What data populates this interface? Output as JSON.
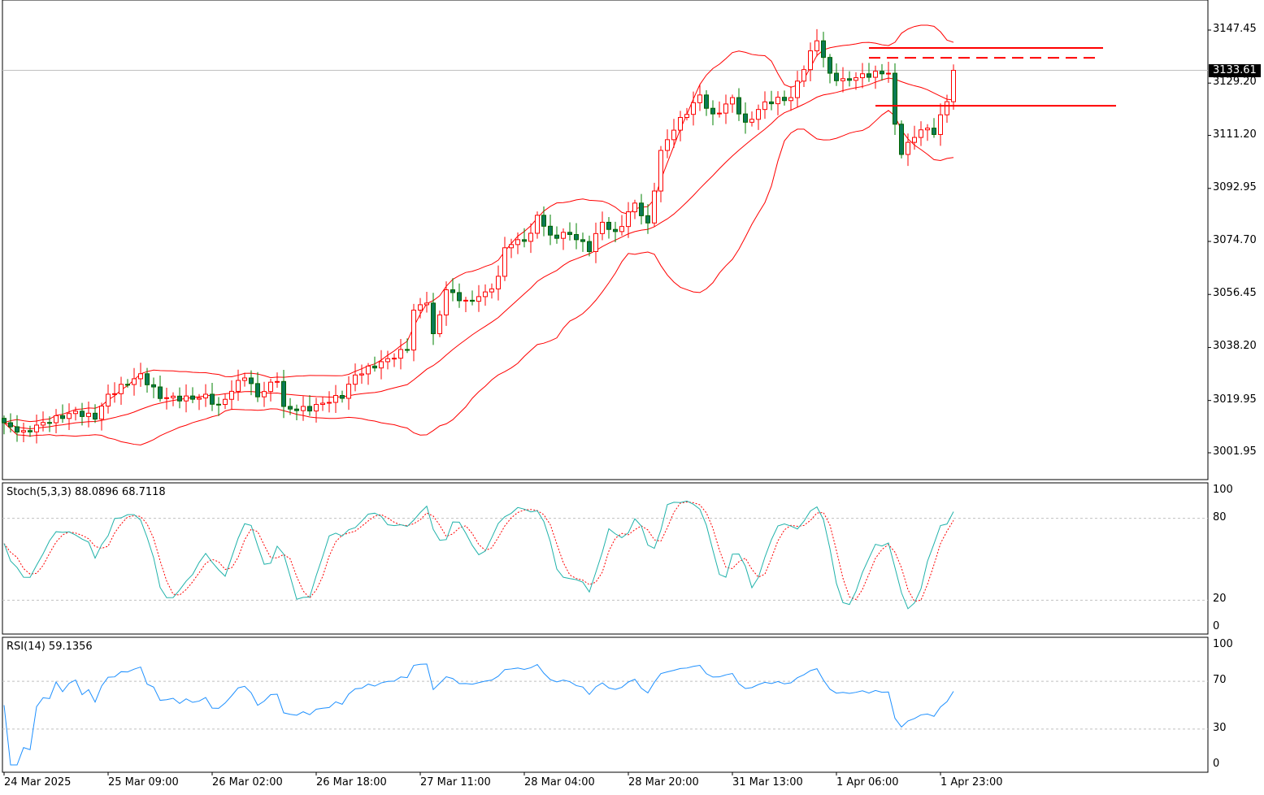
{
  "chart_data": {
    "type": "candlestick",
    "price_axis": {
      "ticks": [
        "3147.45",
        "3129.20",
        "3111.20",
        "3092.95",
        "3074.70",
        "3056.45",
        "3038.20",
        "3019.95",
        "3001.95"
      ],
      "range": [
        3001.95,
        3147.45
      ]
    },
    "current_price": "3133.61",
    "time_axis": {
      "ticks": [
        "24 Mar 2025",
        "25 Mar 09:00",
        "26 Mar 02:00",
        "26 Mar 18:00",
        "27 Mar 11:00",
        "28 Mar 04:00",
        "28 Mar 20:00",
        "31 Mar 13:00",
        "1 Apr 06:00",
        "1 Apr 23:00"
      ],
      "bars_per_tick": 16
    },
    "price_path": [
      [
        0,
        3012.3
      ],
      [
        3,
        3008.1
      ],
      [
        7,
        3012.3
      ],
      [
        11,
        3016.5
      ],
      [
        14,
        3015.1
      ],
      [
        16,
        3022.1
      ],
      [
        21,
        3027.7
      ],
      [
        24,
        3020.7
      ],
      [
        31,
        3022.1
      ],
      [
        33,
        3017.9
      ],
      [
        37,
        3027.7
      ],
      [
        39,
        3020.7
      ],
      [
        42,
        3027.7
      ],
      [
        43,
        3017.9
      ],
      [
        47,
        3017.9
      ],
      [
        52,
        3020.7
      ],
      [
        54,
        3027.7
      ],
      [
        58,
        3033.3
      ],
      [
        62,
        3038.9
      ],
      [
        63,
        3051.5
      ],
      [
        65,
        3054.3
      ],
      [
        66,
        3041.7
      ],
      [
        68,
        3057.1
      ],
      [
        71,
        3052.9
      ],
      [
        74,
        3057.1
      ],
      [
        76,
        3062.7
      ],
      [
        77,
        3073.9
      ],
      [
        81,
        3076.7
      ],
      [
        82,
        3083.7
      ],
      [
        84,
        3075.3
      ],
      [
        87,
        3076.7
      ],
      [
        90,
        3072.5
      ],
      [
        92,
        3082.3
      ],
      [
        94,
        3078.1
      ],
      [
        97,
        3087.9
      ],
      [
        99,
        3079.5
      ],
      [
        101,
        3104.6
      ],
      [
        103,
        3113.0
      ],
      [
        107,
        3125.6
      ],
      [
        109,
        3118.6
      ],
      [
        112,
        3124.2
      ],
      [
        114,
        3114.4
      ],
      [
        117,
        3121.4
      ],
      [
        121,
        3124.2
      ],
      [
        123,
        3135.4
      ],
      [
        125,
        3145.2
      ],
      [
        127,
        3132.6
      ],
      [
        129,
        3129.8
      ],
      [
        133,
        3131.2
      ],
      [
        136,
        3132.6
      ],
      [
        137,
        3114.4
      ],
      [
        138,
        3106.0
      ],
      [
        141,
        3114.4
      ],
      [
        143,
        3113.0
      ],
      [
        145,
        3122.8
      ],
      [
        146,
        3133.6
      ]
    ],
    "horizontal_levels": [
      {
        "price": 3141.3,
        "style": "solid",
        "from_bar": 133,
        "to_bar": 169
      },
      {
        "price": 3137.9,
        "style": "dashed",
        "from_bar": 133,
        "to_bar": 168
      },
      {
        "price": 3121.4,
        "style": "solid",
        "from_bar": 134,
        "to_bar": 171
      }
    ],
    "bollinger": {
      "period": 20,
      "deviation": 2
    },
    "stochastic": {
      "label": "Stoch(5,3,3) 88.0896 68.7118",
      "levels": [
        "100",
        "80",
        "20",
        "0"
      ]
    },
    "rsi": {
      "label": "RSI(14) 59.1356",
      "levels": [
        "100",
        "70",
        "30",
        "0"
      ]
    }
  },
  "colors": {
    "bull": "#ff0000",
    "bear_body": "#0b7a55",
    "bear_wick": "#008000",
    "bands": "#ff0000",
    "stoch_main": "#20b2aa",
    "stoch_signal": "#ff0000",
    "rsi": "#1e90ff"
  }
}
